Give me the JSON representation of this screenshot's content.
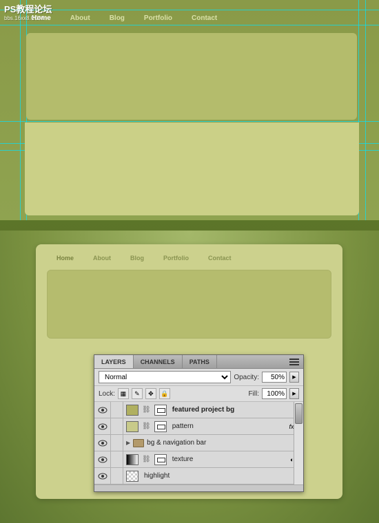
{
  "watermark": {
    "line1": "PS教程论坛",
    "line2": "bbs.16xx8.COM"
  },
  "nav": {
    "items": [
      {
        "label": "Home",
        "active": true
      },
      {
        "label": "About",
        "active": false
      },
      {
        "label": "Blog",
        "active": false
      },
      {
        "label": "Portfolio",
        "active": false
      },
      {
        "label": "Contact",
        "active": false
      }
    ]
  },
  "layers_panel": {
    "tabs": {
      "layers": "LAYERS",
      "channels": "CHANNELS",
      "paths": "PATHS"
    },
    "blend_mode": "Normal",
    "opacity_label": "Opacity:",
    "opacity_value": "50%",
    "lock_label": "Lock:",
    "fill_label": "Fill:",
    "fill_value": "100%",
    "layers": [
      {
        "name": "featured project bg",
        "bold": true,
        "thumbs": [
          "olive",
          "mask"
        ],
        "linked": true
      },
      {
        "name": "pattern",
        "thumbs": [
          "pale",
          "mask"
        ],
        "linked": true,
        "fx": true
      },
      {
        "name": "bg & navigation bar",
        "folder": true
      },
      {
        "name": "texture",
        "thumbs": [
          "grad",
          "mask"
        ],
        "linked": true,
        "adjust": true
      },
      {
        "name": "highlight",
        "thumbs": [
          "checker"
        ]
      }
    ]
  }
}
